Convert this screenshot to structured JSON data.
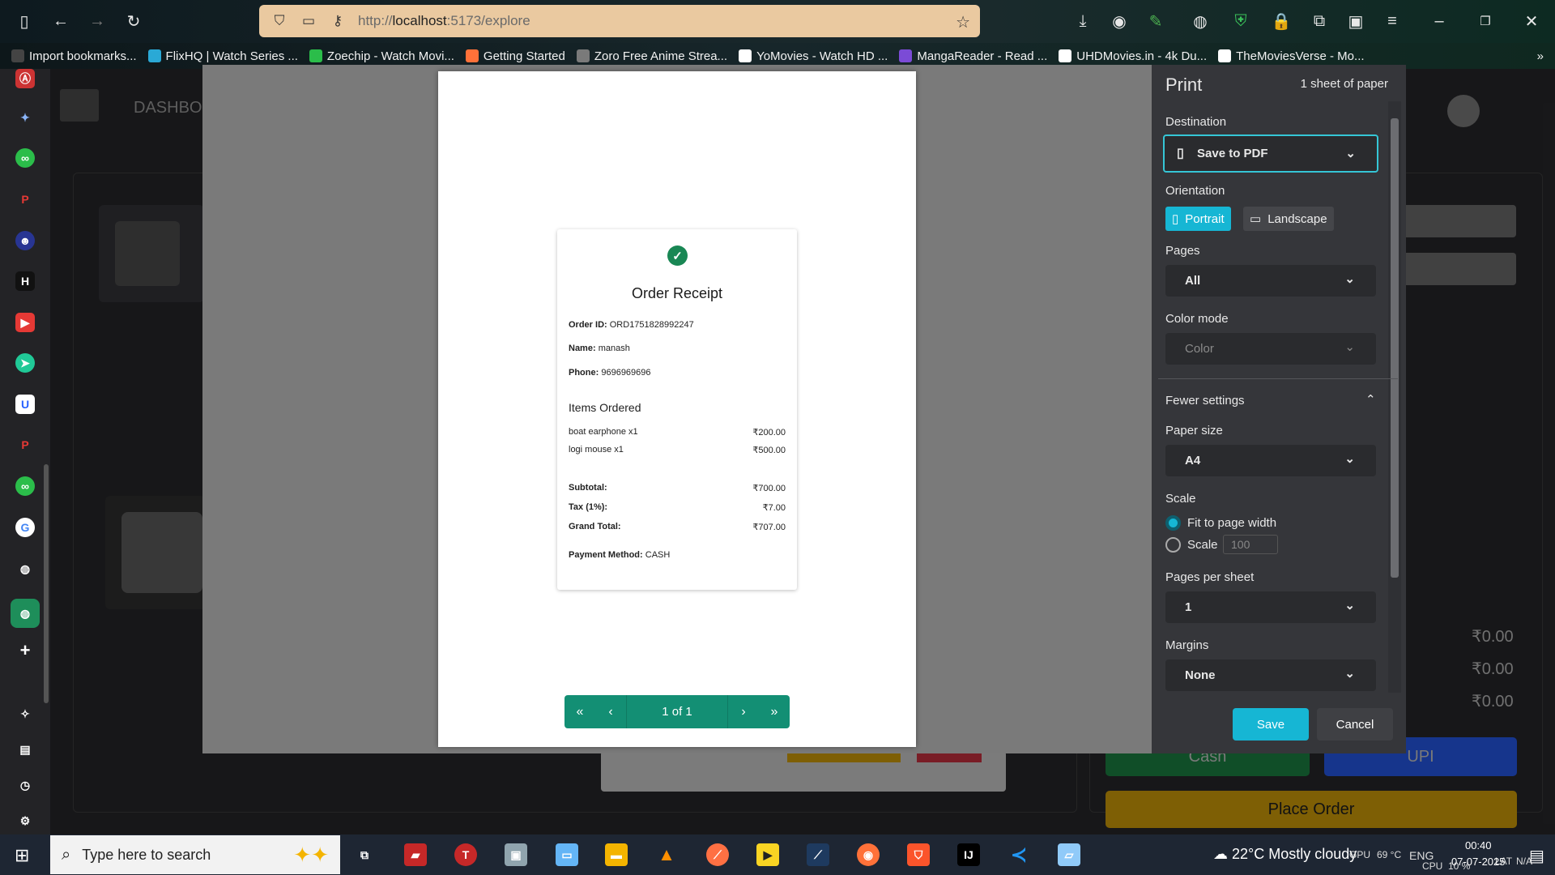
{
  "browser": {
    "url_prefix": "http://",
    "url_host": "localhost",
    "url_rest": ":5173/explore",
    "bookmarks": [
      {
        "label": "Import bookmarks...",
        "color": "#444"
      },
      {
        "label": "FlixHQ | Watch Series ...",
        "color": "#2aa9d6"
      },
      {
        "label": "Zoechip - Watch Movi...",
        "color": "#2bbd4a"
      },
      {
        "label": "Getting Started",
        "color": "#ff7139"
      },
      {
        "label": "Zoro Free Anime Strea...",
        "color": "#7a7a7a"
      },
      {
        "label": "YoMovies - Watch HD ...",
        "color": "#ffffff"
      },
      {
        "label": "MangaReader - Read ...",
        "color": "#7b4bd6"
      },
      {
        "label": "UHDMovies.in - 4k Du...",
        "color": "#ffffff"
      },
      {
        "label": "TheMoviesVerse - Mo...",
        "color": "#ffffff"
      }
    ]
  },
  "app_background": {
    "title": "DASHBO",
    "amounts": [
      "₹0.00",
      "₹0.00",
      "₹0.00"
    ],
    "cash_label": "Cash",
    "upi_label": "UPI",
    "place_order_label": "Place Order"
  },
  "receipt": {
    "title": "Order Receipt",
    "order_id_label": "Order ID:",
    "order_id": "ORD1751828992247",
    "name_label": "Name:",
    "name": "manash",
    "phone_label": "Phone:",
    "phone": "9696969696",
    "items_heading": "Items Ordered",
    "items": [
      {
        "name": "boat earphone x1",
        "price": "₹200.00"
      },
      {
        "name": "logi mouse x1",
        "price": "₹500.00"
      }
    ],
    "subtotal_label": "Subtotal:",
    "subtotal": "₹700.00",
    "tax_label": "Tax (1%):",
    "tax": "₹7.00",
    "grand_total_label": "Grand Total:",
    "grand_total": "₹707.00",
    "payment_label": "Payment Method:",
    "payment": "CASH"
  },
  "pager": {
    "label": "1 of 1"
  },
  "print": {
    "title": "Print",
    "sheets": "1 sheet of paper",
    "destination_label": "Destination",
    "destination": "Save to PDF",
    "orientation_label": "Orientation",
    "portrait": "Portrait",
    "landscape": "Landscape",
    "pages_label": "Pages",
    "pages": "All",
    "color_mode_label": "Color mode",
    "color_mode": "Color",
    "fewer_settings": "Fewer settings",
    "paper_size_label": "Paper size",
    "paper_size": "A4",
    "scale_label": "Scale",
    "fit_label": "Fit to page width",
    "scale_option": "Scale",
    "scale_value": "100",
    "pps_label": "Pages per sheet",
    "pps": "1",
    "margins_label": "Margins",
    "margins": "None",
    "save": "Save",
    "cancel": "Cancel",
    "accent": "#35c6d6"
  },
  "taskbar": {
    "search_placeholder": "Type here to search",
    "weather_temp": "22°C",
    "weather_text": "Mostly cloudy",
    "gpu": "GPU",
    "gpu_val": "69 °C",
    "lang": "ENG",
    "cpu": "CPU",
    "cpu_val": "10 %",
    "lat": "LAT",
    "lat_val": "N/A",
    "time": "00:40",
    "date": "07-07-2025"
  }
}
